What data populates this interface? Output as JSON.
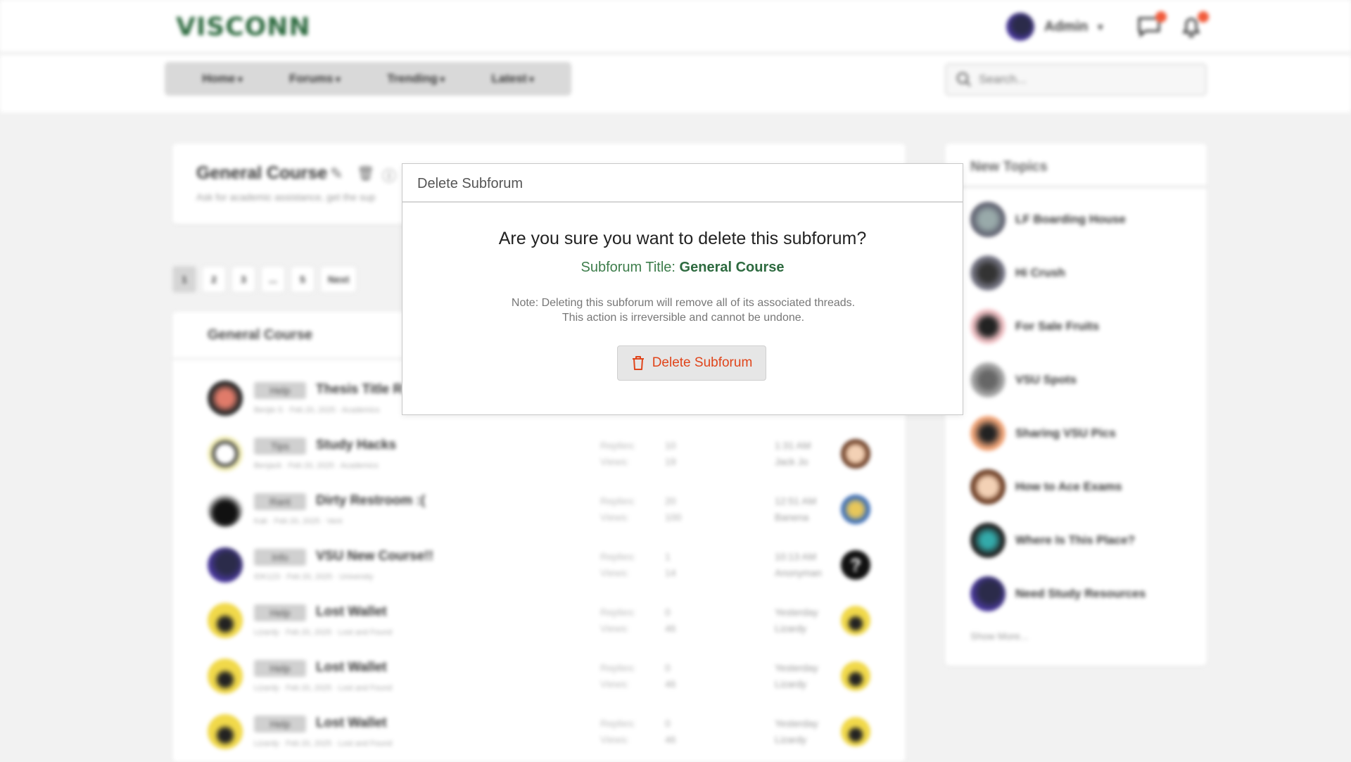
{
  "header": {
    "logo": "VISCONN",
    "user_name": "Admin",
    "nav": [
      "Home",
      "Forums",
      "Trending",
      "Latest"
    ],
    "search_placeholder": "Search..."
  },
  "subforum": {
    "title": "General Course",
    "description": "Ask for academic assistance, get the sup",
    "pagination": [
      "1",
      "2",
      "3",
      "...",
      "5",
      "Next"
    ],
    "list_title": "General Course"
  },
  "threads": [
    {
      "tag": "Help",
      "title": "Thesis Title R",
      "meta": "Benjie S · Feb 20, 2025 · Academics",
      "replies_label": "",
      "views_label": "",
      "replies": "",
      "views": "",
      "last_time": "",
      "last_user": ""
    },
    {
      "tag": "Tips",
      "title": "Study Hacks",
      "meta": "Benjack · Feb 20, 2025 · Academics",
      "replies_label": "Replies:",
      "views_label": "Views:",
      "replies": "10",
      "views": "19",
      "last_time": "1:31 AM",
      "last_user": "Jack Jo"
    },
    {
      "tag": "Rant",
      "title": "Dirty Restroom :(",
      "meta": "Kak · Feb 20, 2025 · Vent",
      "replies_label": "Replies:",
      "views_label": "Views:",
      "replies": "20",
      "views": "100",
      "last_time": "12:51 AM",
      "last_user": "Banena"
    },
    {
      "tag": "Info",
      "title": "VSU New Course!!",
      "meta": "IDK123 · Feb 20, 2025 · University",
      "replies_label": "Replies:",
      "views_label": "Views:",
      "replies": "1",
      "views": "14",
      "last_time": "10:13 AM",
      "last_user": "Anonyman"
    },
    {
      "tag": "Help",
      "title": "Lost Wallet",
      "meta": "Lizardy · Feb 20, 2025 · Lost and Found",
      "replies_label": "Replies:",
      "views_label": "Views:",
      "replies": "0",
      "views": "46",
      "last_time": "Yesterday",
      "last_user": "Lizardy"
    },
    {
      "tag": "Help",
      "title": "Lost Wallet",
      "meta": "Lizardy · Feb 20, 2025 · Lost and Found",
      "replies_label": "Replies:",
      "views_label": "Views:",
      "replies": "0",
      "views": "46",
      "last_time": "Yesterday",
      "last_user": "Lizardy"
    },
    {
      "tag": "Help",
      "title": "Lost Wallet",
      "meta": "Lizardy · Feb 20, 2025 · Lost and Found",
      "replies_label": "Replies:",
      "views_label": "Views:",
      "replies": "0",
      "views": "46",
      "last_time": "Yesterday",
      "last_user": "Lizardy"
    }
  ],
  "new_topics": {
    "title": "New Topics",
    "items": [
      "LF Boarding House",
      "Hi Crush",
      "For Sale Fruits",
      "VSU Spots",
      "Sharing VSU Pics",
      "How to Ace Exams",
      "Where Is This Place?",
      "Need Study Resources"
    ],
    "show_more": "Show More..."
  },
  "modal": {
    "header": "Delete Subforum",
    "question": "Are you sure you want to delete this subforum?",
    "subtitle_label": "Subforum Title: ",
    "subtitle_value": "General Course",
    "note": "Note: Deleting this subforum will remove all of its associated threads. This action is irreversible and cannot be undone.",
    "button_label": "Delete Subforum"
  },
  "colors": {
    "brand": "#2d6a3f",
    "danger": "#e0451b",
    "notification": "#f15b3b"
  }
}
